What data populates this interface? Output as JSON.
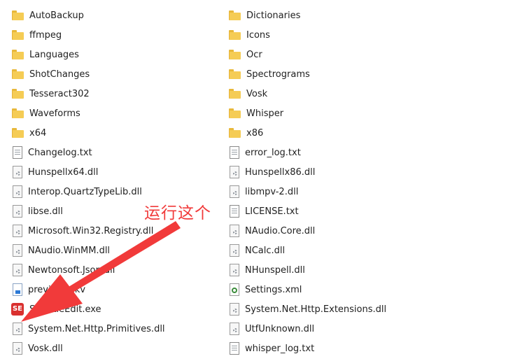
{
  "annotation": {
    "text": "运行这个",
    "color": "#f13a3a"
  },
  "left_column": [
    {
      "name": "AutoBackup",
      "type": "folder"
    },
    {
      "name": "ffmpeg",
      "type": "folder"
    },
    {
      "name": "Languages",
      "type": "folder"
    },
    {
      "name": "ShotChanges",
      "type": "folder"
    },
    {
      "name": "Tesseract302",
      "type": "folder"
    },
    {
      "name": "Waveforms",
      "type": "folder"
    },
    {
      "name": "x64",
      "type": "folder"
    },
    {
      "name": "Changelog.txt",
      "type": "txt"
    },
    {
      "name": "Hunspellx64.dll",
      "type": "dll"
    },
    {
      "name": "Interop.QuartzTypeLib.dll",
      "type": "dll"
    },
    {
      "name": "libse.dll",
      "type": "dll"
    },
    {
      "name": "Microsoft.Win32.Registry.dll",
      "type": "dll"
    },
    {
      "name": "NAudio.WinMM.dll",
      "type": "dll"
    },
    {
      "name": "Newtonsoft.Json.dll",
      "type": "dll"
    },
    {
      "name": "preview.mkv",
      "type": "ml"
    },
    {
      "name": "SubtitleEdit.exe",
      "type": "exe",
      "icon_text": "SE"
    },
    {
      "name": "System.Net.Http.Primitives.dll",
      "type": "dll"
    },
    {
      "name": "Vosk.dll",
      "type": "dll"
    }
  ],
  "right_column": [
    {
      "name": "Dictionaries",
      "type": "folder"
    },
    {
      "name": "Icons",
      "type": "folder"
    },
    {
      "name": "Ocr",
      "type": "folder"
    },
    {
      "name": "Spectrograms",
      "type": "folder"
    },
    {
      "name": "Vosk",
      "type": "folder"
    },
    {
      "name": "Whisper",
      "type": "folder"
    },
    {
      "name": "x86",
      "type": "folder"
    },
    {
      "name": "error_log.txt",
      "type": "txt"
    },
    {
      "name": "Hunspellx86.dll",
      "type": "dll"
    },
    {
      "name": "libmpv-2.dll",
      "type": "dll"
    },
    {
      "name": "LICENSE.txt",
      "type": "txt"
    },
    {
      "name": "NAudio.Core.dll",
      "type": "dll"
    },
    {
      "name": "NCalc.dll",
      "type": "dll"
    },
    {
      "name": "NHunspell.dll",
      "type": "dll"
    },
    {
      "name": "Settings.xml",
      "type": "xml"
    },
    {
      "name": "System.Net.Http.Extensions.dll",
      "type": "dll"
    },
    {
      "name": "UtfUnknown.dll",
      "type": "dll"
    },
    {
      "name": "whisper_log.txt",
      "type": "txt"
    }
  ]
}
